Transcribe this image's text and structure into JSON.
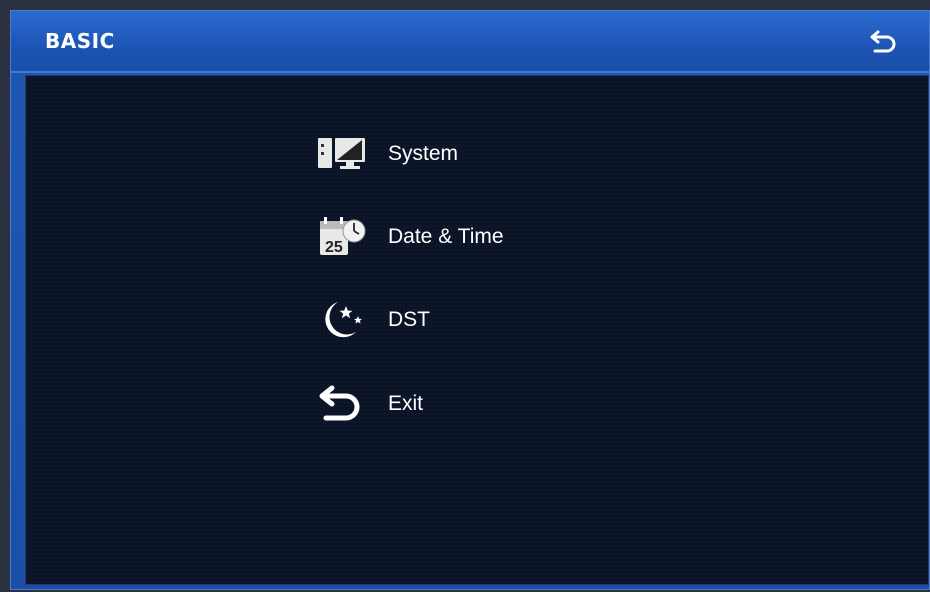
{
  "window": {
    "title": "BASIC"
  },
  "menu": {
    "items": [
      {
        "label": "System",
        "icon": "system-monitor-icon"
      },
      {
        "label": "Date & Time",
        "icon": "calendar-clock-icon"
      },
      {
        "label": "DST",
        "icon": "moon-stars-icon"
      },
      {
        "label": "Exit",
        "icon": "return-arrow-icon"
      }
    ]
  },
  "colors": {
    "title_bar": "#1e58b4",
    "content_bg": "#0b1327",
    "text": "#ffffff"
  }
}
